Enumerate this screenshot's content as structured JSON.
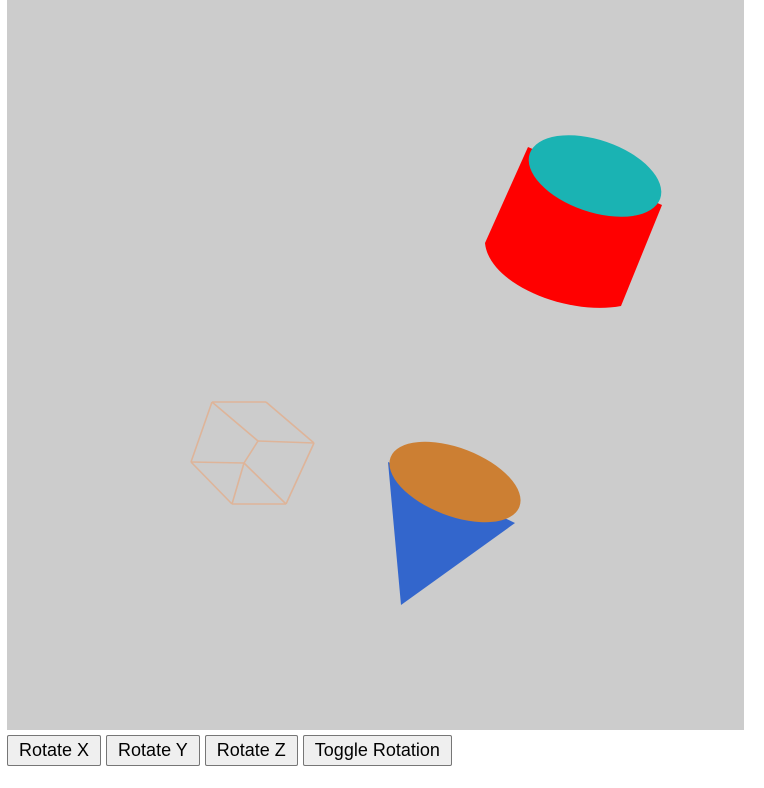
{
  "scene": {
    "background_color": "#cccccc",
    "objects": [
      {
        "name": "cube",
        "style": "wireframe",
        "color": "#deb499"
      },
      {
        "name": "cylinder",
        "side_color": "#ff0000",
        "top_color": "#1ab3b3"
      },
      {
        "name": "cone",
        "side_color": "#3366cc",
        "base_color": "#cc7f33"
      }
    ]
  },
  "controls": {
    "rotate_x_label": "Rotate X",
    "rotate_y_label": "Rotate Y",
    "rotate_z_label": "Rotate Z",
    "toggle_rotation_label": "Toggle Rotation"
  }
}
